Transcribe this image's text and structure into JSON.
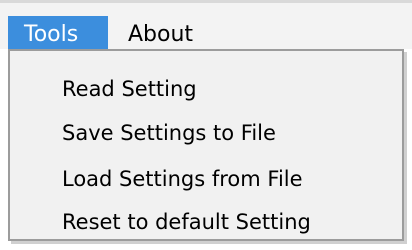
{
  "menubar": {
    "items": [
      {
        "label": "Tools",
        "active": true
      },
      {
        "label": "About",
        "active": false
      }
    ],
    "highlight_color": "#3c8edd"
  },
  "dropdown": {
    "items": [
      {
        "label": "Read Setting"
      },
      {
        "label": "Save Settings to File"
      },
      {
        "label": "Load Settings from File"
      },
      {
        "label": "Reset to default Setting"
      }
    ]
  }
}
